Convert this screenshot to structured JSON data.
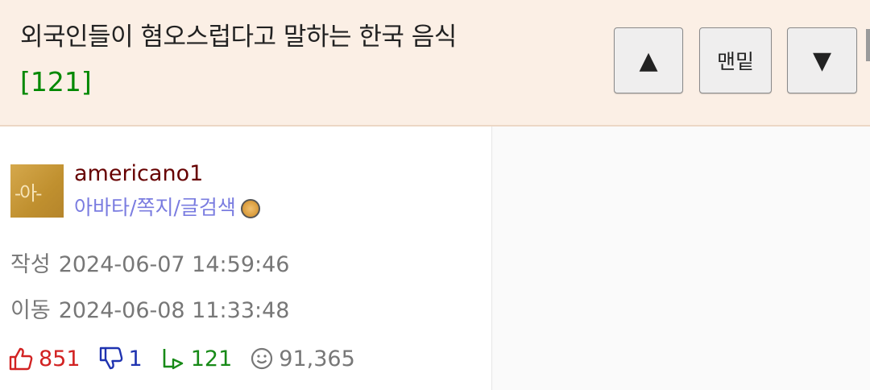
{
  "header": {
    "title": "외국인들이 혐오스럽다고 말하는 한국 음식",
    "comment_count": "[121]",
    "buttons": {
      "up_label": "▲",
      "bottom_label": "맨밑",
      "down_label": "▼"
    }
  },
  "author": {
    "name": "americano1",
    "avatar_text": "-아-",
    "links": [
      "아바타",
      "쪽지",
      "글검색"
    ],
    "separator": "/",
    "level_icon": "level-badge-icon"
  },
  "meta": {
    "created_label": "작성",
    "created_value": "2024-06-07 14:59:46",
    "moved_label": "이동",
    "moved_value": "2024-06-08 11:33:48"
  },
  "stats": {
    "upvotes": "851",
    "downvotes": "1",
    "replies": "121",
    "views": "91,365",
    "colors": {
      "up": "#d22222",
      "down": "#1f33b0",
      "reply": "#178a17",
      "view": "#777777"
    }
  }
}
